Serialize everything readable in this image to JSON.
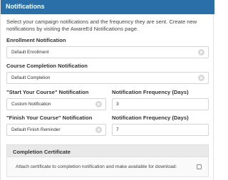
{
  "header": {
    "title": "Notifications"
  },
  "intro": "Select your campaign notifications and the frequency they are sent. Create new notifications by visiting the AwareEd Notifications page.",
  "enrollment": {
    "label": "Enrollment Notification",
    "value": "Default Enrollment"
  },
  "completion": {
    "label": "Course Completion Notification",
    "value": "Default Completion"
  },
  "start": {
    "label": "\"Start Your Course\" Notification",
    "value": "Custom Notification",
    "freq_label": "Notification Frequency (Days)",
    "freq_value": "3"
  },
  "finish": {
    "label": "\"Finish Your Course\" Notification",
    "value": "Default Finish Reminder",
    "freq_label": "Notification Frequency (Days)",
    "freq_value": "7"
  },
  "certificate": {
    "title": "Completion Certificate",
    "checkbox_label": "Attach certificate to completion notification and make available for download:",
    "checked": false
  },
  "colors": {
    "header_bg": "#2a6fa8",
    "header_text": "#ffffff"
  },
  "icons": {
    "clear": "clear-x-icon"
  }
}
